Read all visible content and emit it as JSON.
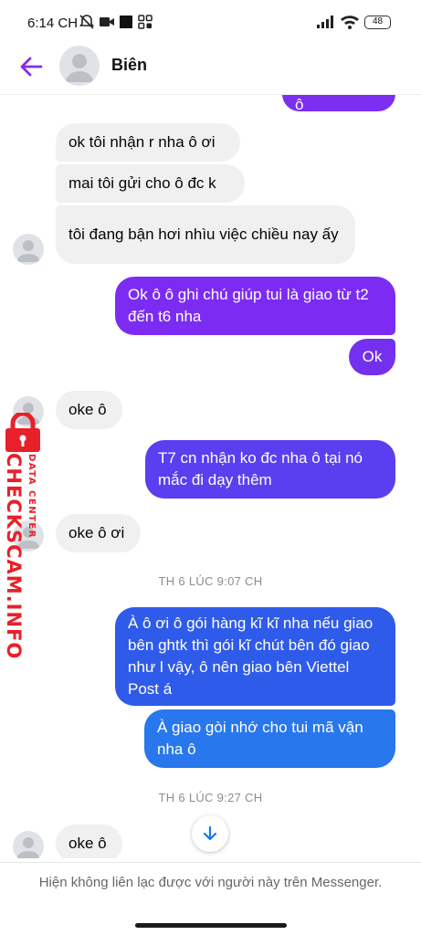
{
  "status_bar": {
    "time": "6:14 CH",
    "battery": "48"
  },
  "header": {
    "contact_name": "Biên"
  },
  "messages": [
    {
      "text": "Quá chuẩn ô"
    },
    {
      "text": "ok tôi nhận r nha ô ơi"
    },
    {
      "text": "mai tôi gửi cho ô đc k"
    },
    {
      "text": "tôi đang bận hơi nhìu việc chiều nay ấy"
    },
    {
      "text": "Ok ô ô ghi chú giúp tui là giao từ t2 đến t6 nha"
    },
    {
      "text": "Ok"
    },
    {
      "text": "oke ô"
    },
    {
      "text": "T7 cn nhận ko đc nha ô tại nó mắc đi dạy thêm"
    },
    {
      "text": "oke ô ơi"
    },
    {
      "text": "À ô ơi ô gói hàng kĩ kĩ nha nếu giao bên ghtk thì gói kĩ chút bên đó giao như l vậy, ô nên giao bên Viettel Post á"
    },
    {
      "text": "À giao gòi nhớ cho tui mã vận nha ô"
    },
    {
      "text": "oke ô"
    }
  ],
  "timestamps": [
    "TH 6 LÚC 9:07 CH",
    "TH 6 LÚC 9:27 CH"
  ],
  "watermark": {
    "brand": "CHECKSCAM.INFO",
    "sub": "DATA CENTER"
  },
  "footer": {
    "notice": "Hiện không liên lạc được với người này trên Messenger."
  },
  "colors": {
    "accent": "#7b2ff0",
    "out_purple": "#7c2cf2",
    "out_indigo": "#5a3ff0",
    "out_blue": "#2f5bea",
    "out_blue2": "#2877ec",
    "incoming": "#f0f0f0",
    "watermark": "#e8202a"
  },
  "icons": [
    "back-arrow-icon",
    "avatar-icon",
    "scroll-down-arrow-icon",
    "lock-icon",
    "wifi-icon",
    "signal-icon",
    "video-icon",
    "muted-notification-icon"
  ]
}
